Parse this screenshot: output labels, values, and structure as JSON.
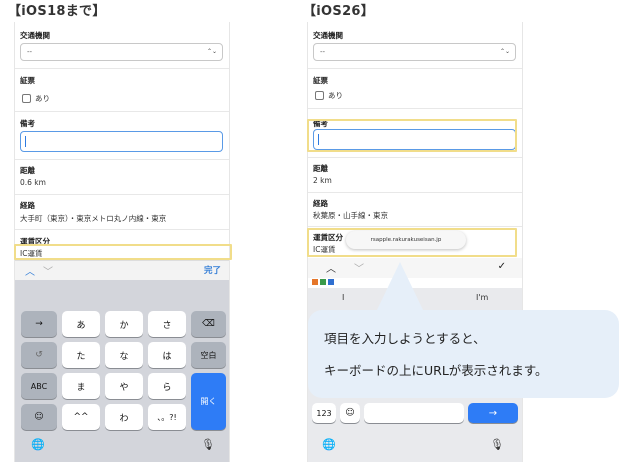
{
  "left": {
    "heading": "【iOS18まで】",
    "fields": {
      "transport_label": "交通機関",
      "transport_value": "--",
      "receipt_label": "証票",
      "receipt_check": "あり",
      "remarks_label": "備考",
      "distance_label": "距離",
      "distance_value": "0.6 km",
      "route_label": "経路",
      "route_value": "大手町（東京）・東京メトロ丸ノ内線・東京",
      "fare_label": "運賃区分",
      "fare_value": "IC運賃"
    },
    "toolbar": {
      "up": "︿",
      "down": "﹀",
      "done": "完了"
    },
    "keys": {
      "row1": [
        "→",
        "あ",
        "か",
        "さ",
        "⌫"
      ],
      "row2": [
        "↺",
        "た",
        "な",
        "は",
        "空白"
      ],
      "row3": [
        "ABC",
        "ま",
        "や",
        "ら"
      ],
      "row4": [
        "☺",
        "^^",
        "わ",
        "、。?!"
      ],
      "enter": "開く",
      "globe": "🌐",
      "mic": "🎙"
    }
  },
  "right": {
    "heading": "【iOS26】",
    "fields": {
      "transport_label": "交通機関",
      "transport_value": "--",
      "receipt_label": "証票",
      "receipt_check": "あり",
      "remarks_label": "備考",
      "distance_label": "距離",
      "distance_value": "2 km",
      "route_label": "経路",
      "route_value": "秋葉原・山手線・東京",
      "fare_label": "運賃区分",
      "fare_value": "IC運賃"
    },
    "url": "rsapple.rakurakuseisan.jp",
    "toolbar": {
      "up": "︿",
      "down": "﹀",
      "check": "✓"
    },
    "suggestions": [
      "I",
      "I'm"
    ],
    "keys": {
      "k123": "123",
      "emoji": "☺",
      "enter": "→",
      "globe": "🌐",
      "mic": "🎙"
    }
  },
  "callout": {
    "line1": "項目を入力しようとすると、",
    "line2": "キーボードの上にURLが表示されます。"
  },
  "colors": {
    "highlight": "#f1dd8a",
    "callout_bg": "#e6eff9",
    "accent_blue": "#2e7cf6"
  }
}
